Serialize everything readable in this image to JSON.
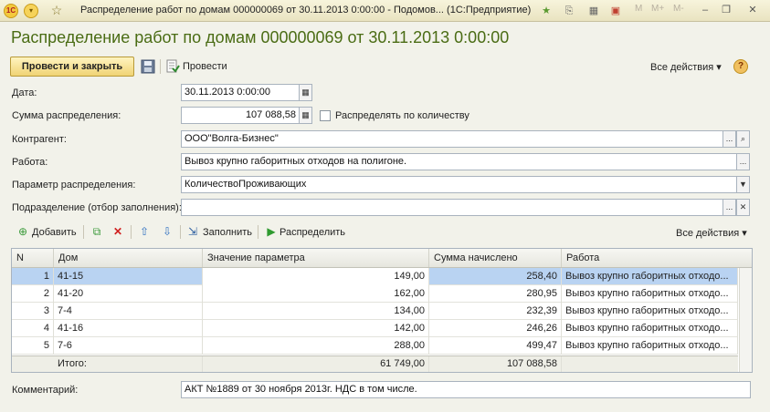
{
  "window": {
    "title": "Распределение работ по домам 000000069 от 30.11.2013 0:00:00 - Подомов... (1С:Предприятие)",
    "logo_text": "1С",
    "memory_buttons": [
      "M",
      "M+",
      "M-"
    ]
  },
  "form": {
    "heading": "Распределение работ по домам 000000069 от 30.11.2013 0:00:00"
  },
  "toolbar": {
    "post_close_label": "Провести и закрыть",
    "post_label": "Провести",
    "all_actions_label": "Все действия ▾",
    "help_label": "?"
  },
  "fields": {
    "date": {
      "label": "Дата:",
      "value": "30.11.2013  0:00:00"
    },
    "amount": {
      "label": "Сумма распределения:",
      "value": "107 088,58"
    },
    "by_quantity": {
      "label": "Распределять по количеству",
      "checked": false
    },
    "counterparty": {
      "label": "Контрагент:",
      "value": "ООО\"Волга-Бизнес\""
    },
    "work": {
      "label": "Работа:",
      "value": "Вывоз крупно габоритных отходов  на полигоне."
    },
    "param": {
      "label": "Параметр распределения:",
      "value": "КоличествоПроживающих"
    },
    "division": {
      "label": "Подразделение (отбор заполнения):",
      "value": ""
    },
    "comment": {
      "label": "Комментарий:",
      "value": "АКТ №1889  от 30 ноября 2013г. НДС в том числе."
    }
  },
  "table_toolbar": {
    "add_label": "Добавить",
    "fill_label": "Заполнить",
    "distribute_label": "Распределить",
    "all_actions_label": "Все действия ▾"
  },
  "table": {
    "columns": [
      "N",
      "Дом",
      "Значение параметра",
      "Сумма начислено",
      "Работа"
    ],
    "rows": [
      {
        "n": "1",
        "house": "41-15",
        "param": "149,00",
        "sum": "258,40",
        "work": "Вывоз крупно габоритных отходо..."
      },
      {
        "n": "2",
        "house": "41-20",
        "param": "162,00",
        "sum": "280,95",
        "work": "Вывоз крупно габоритных отходо..."
      },
      {
        "n": "3",
        "house": "7-4",
        "param": "134,00",
        "sum": "232,39",
        "work": "Вывоз крупно габоритных отходо..."
      },
      {
        "n": "4",
        "house": "41-16",
        "param": "142,00",
        "sum": "246,26",
        "work": "Вывоз крупно габоритных отходо..."
      },
      {
        "n": "5",
        "house": "7-6",
        "param": "288,00",
        "sum": "499,47",
        "work": "Вывоз крупно габоритных отходо..."
      }
    ],
    "footer": {
      "label": "Итого:",
      "param_total": "61 749,00",
      "sum_total": "107 088,58"
    }
  }
}
